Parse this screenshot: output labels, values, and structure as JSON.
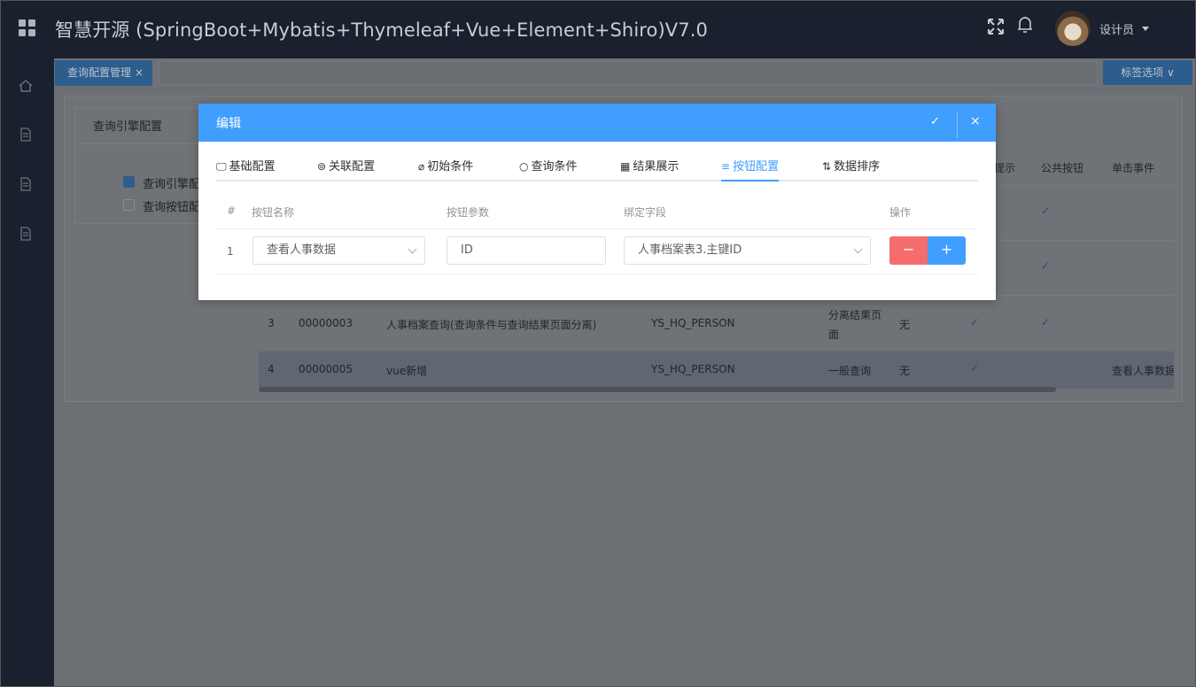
{
  "header": {
    "title": "智慧开源 (SpringBoot+Mybatis+Thymeleaf+Vue+Element+Shiro)V7.0",
    "user_name": "设计员"
  },
  "tabs_bar": {
    "active_tab": "查询配置管理",
    "tab_close": "×",
    "options_label": "标签选项 ∨"
  },
  "left_card": {
    "title": "查询引擎配置",
    "items": [
      {
        "label": "查询引擎配",
        "checked": true
      },
      {
        "label": "查询按钮配",
        "checked": false
      }
    ]
  },
  "bg_table": {
    "headers": [
      "提示",
      "公共按钮",
      "单击事件"
    ],
    "rows": [
      {
        "num": "3",
        "code": "00000003",
        "name": "人事档案查询(查询条件与查询结果页面分离)",
        "table": "YS_HQ_PERSON",
        "type_line1": "分离结果页",
        "type_line2": "面",
        "extra": "无",
        "event": ""
      },
      {
        "num": "4",
        "code": "00000005",
        "name": "vue新增",
        "table": "YS_HQ_PERSON",
        "type_line1": "一般查询",
        "type_line2": "",
        "extra": "无",
        "event": "查看人事数据"
      }
    ]
  },
  "modal": {
    "title": "编辑",
    "ok_icon": "✓",
    "close_icon": "×",
    "tabs": [
      {
        "label": "基础配置",
        "icon": "monitor-icon",
        "glyph": "🖵"
      },
      {
        "label": "关联配置",
        "icon": "link-icon",
        "glyph": "⊚"
      },
      {
        "label": "初始条件",
        "icon": "paperclip-icon",
        "glyph": "⌀"
      },
      {
        "label": "查询条件",
        "icon": "search-icon",
        "glyph": "○"
      },
      {
        "label": "结果展示",
        "icon": "calendar-icon",
        "glyph": "▦"
      },
      {
        "label": "按钮配置",
        "icon": "sliders-icon",
        "glyph": "≡"
      },
      {
        "label": "数据排序",
        "icon": "sort-icon",
        "glyph": "⇅"
      }
    ],
    "active_tab": "按钮配置",
    "table": {
      "headers": {
        "num": "#",
        "name": "按钮名称",
        "param": "按钮参数",
        "field": "绑定字段",
        "ops": "操作"
      },
      "rows": [
        {
          "num": "1",
          "name": "查看人事数据",
          "param": "ID",
          "field": "人事档案表3.主键ID"
        }
      ],
      "minus_label": "−",
      "plus_label": "+"
    }
  }
}
